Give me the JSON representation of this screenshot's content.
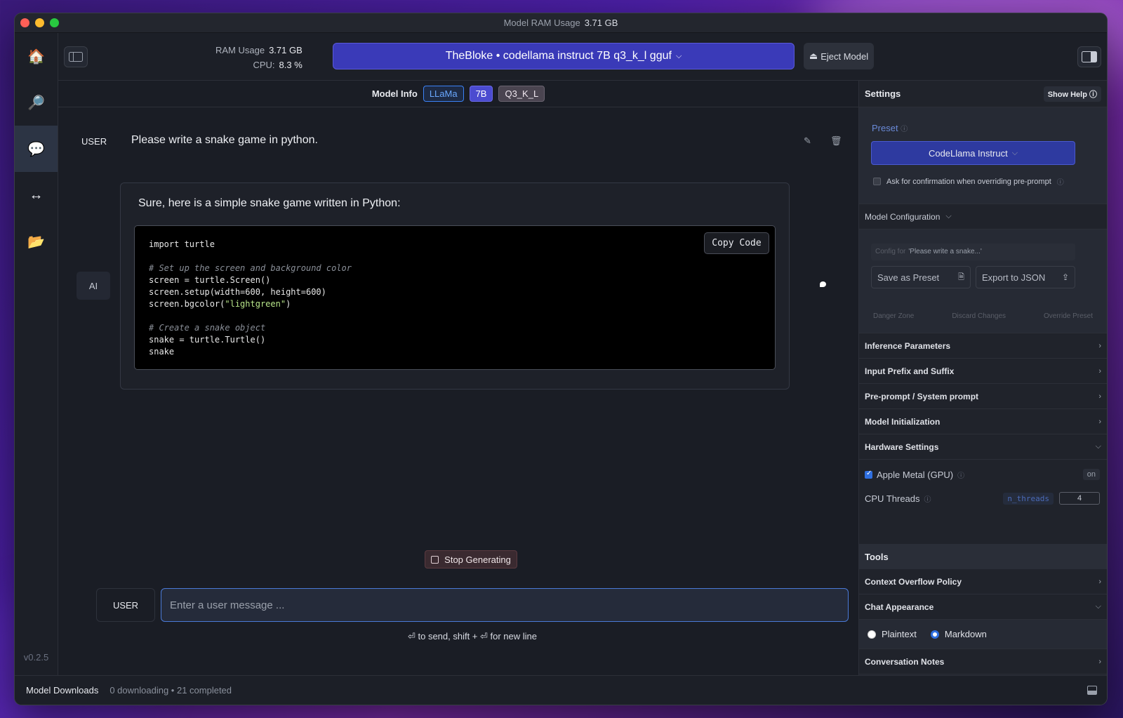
{
  "titlebar": {
    "label": "Model RAM Usage",
    "value": "3.71 GB"
  },
  "nav": {
    "items": [
      {
        "icon": "🏠",
        "name": "home"
      },
      {
        "icon": "🔎",
        "name": "search"
      },
      {
        "icon": "💬",
        "name": "chat"
      },
      {
        "icon": "↔",
        "name": "server"
      },
      {
        "icon": "📂",
        "name": "models-folder"
      }
    ],
    "version": "v0.2.5"
  },
  "topbar": {
    "ram_label": "RAM Usage",
    "ram_value": "3.71 GB",
    "cpu_label": "CPU:",
    "cpu_value": "8.3 %",
    "model_name": "TheBloke • codellama instruct 7B q3_k_l gguf",
    "eject_label": "Eject Model"
  },
  "model_info": {
    "label": "Model Info",
    "tags": [
      "LLaMa",
      "7B",
      "Q3_K_L"
    ]
  },
  "conversation": {
    "user_role": "USER",
    "user_message": "Please write a snake game in python.",
    "ai_role": "AI",
    "ai_intro": "Sure, here is a simple snake game written in Python:",
    "copy_label": "Copy Code",
    "code_lines": [
      "import turtle",
      "",
      "# Set up the screen and background color",
      "screen = turtle.Screen()",
      "screen.setup(width=600, height=600)",
      "screen.bgcolor(\"lightgreen\")",
      "",
      "# Create a snake object",
      "snake = turtle.Turtle()",
      "snake"
    ]
  },
  "composer": {
    "stop_label": "Stop Generating",
    "role": "USER",
    "placeholder": "Enter a user message ...",
    "hint": "⏎ to send, shift + ⏎ for new line"
  },
  "settings": {
    "title": "Settings",
    "show_help": "Show Help",
    "preset_label": "Preset",
    "preset_value": "CodeLlama Instruct",
    "confirm_text": "Ask for confirmation when overriding pre-prompt",
    "model_config_label": "Model Configuration",
    "config_for_label": "Config for",
    "config_for_value": "'Please write a snake...'",
    "save_preset": "Save as Preset",
    "export_json": "Export to JSON",
    "danger_zone": "Danger Zone",
    "discard_changes": "Discard Changes",
    "override_preset": "Override Preset",
    "sections": [
      "Inference Parameters",
      "Input Prefix and Suffix",
      "Pre-prompt / System prompt",
      "Model Initialization",
      "Hardware Settings"
    ],
    "gpu_label": "Apple Metal (GPU)",
    "gpu_state": "on",
    "threads_label": "CPU Threads",
    "threads_param": "n_threads",
    "threads_value": "4",
    "tools_label": "Tools",
    "context_overflow": "Context Overflow Policy",
    "chat_appearance": "Chat Appearance",
    "plaintext": "Plaintext",
    "markdown": "Markdown",
    "conversation_notes": "Conversation Notes"
  },
  "footer": {
    "label": "Model Downloads",
    "status": "0 downloading • 21 completed"
  }
}
